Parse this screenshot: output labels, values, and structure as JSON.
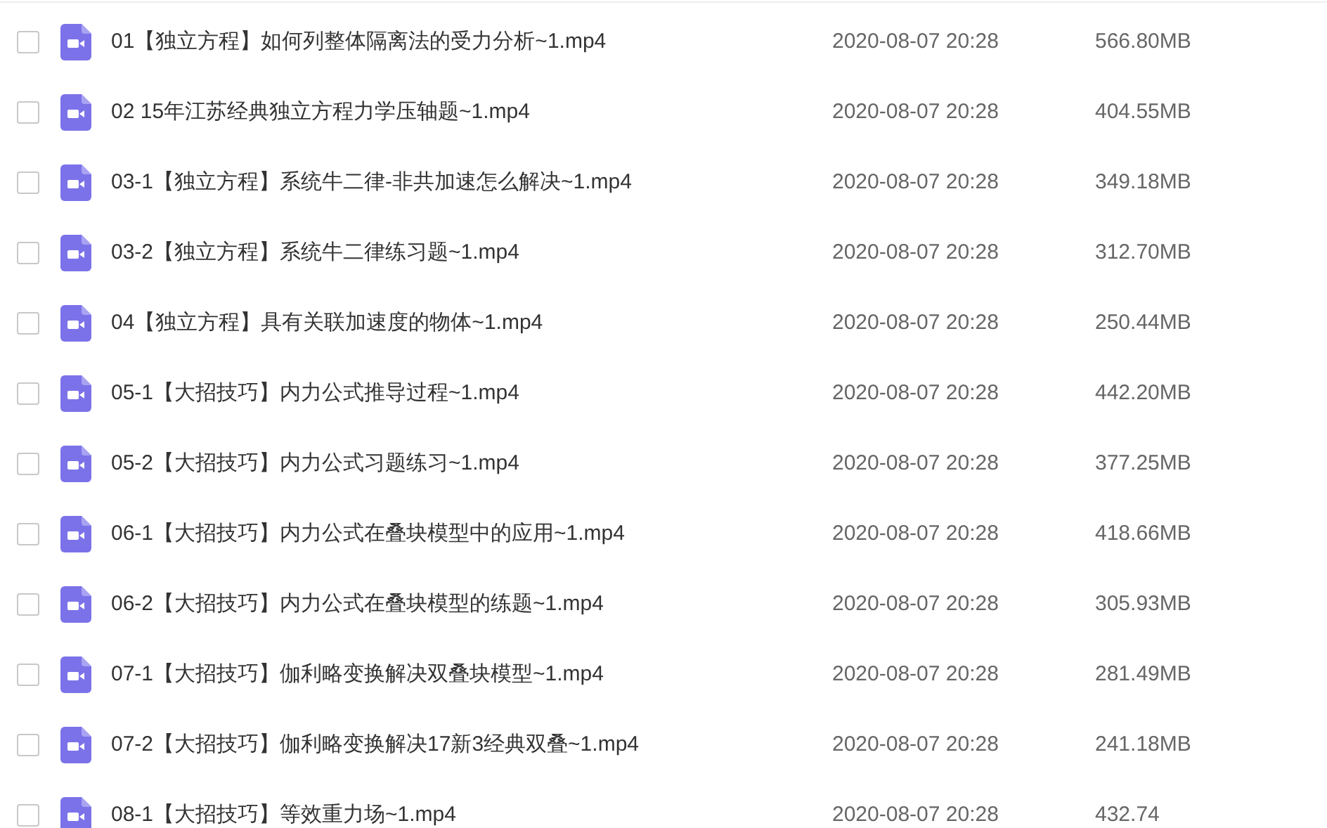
{
  "files": [
    {
      "name": "01【独立方程】如何列整体隔离法的受力分析~1.mp4",
      "modified": "2020-08-07 20:28",
      "size": "566.80MB",
      "checked": false
    },
    {
      "name": "02 15年江苏经典独立方程力学压轴题~1.mp4",
      "modified": "2020-08-07 20:28",
      "size": "404.55MB",
      "checked": false
    },
    {
      "name": "03-1【独立方程】系统牛二律-非共加速怎么解决~1.mp4",
      "modified": "2020-08-07 20:28",
      "size": "349.18MB",
      "checked": false
    },
    {
      "name": "03-2【独立方程】系统牛二律练习题~1.mp4",
      "modified": "2020-08-07 20:28",
      "size": "312.70MB",
      "checked": false
    },
    {
      "name": "04【独立方程】具有关联加速度的物体~1.mp4",
      "modified": "2020-08-07 20:28",
      "size": "250.44MB",
      "checked": false
    },
    {
      "name": "05-1【大招技巧】内力公式推导过程~1.mp4",
      "modified": "2020-08-07 20:28",
      "size": "442.20MB",
      "checked": false
    },
    {
      "name": "05-2【大招技巧】内力公式习题练习~1.mp4",
      "modified": "2020-08-07 20:28",
      "size": "377.25MB",
      "checked": false
    },
    {
      "name": "06-1【大招技巧】内力公式在叠块模型中的应用~1.mp4",
      "modified": "2020-08-07 20:28",
      "size": "418.66MB",
      "checked": false
    },
    {
      "name": "06-2【大招技巧】内力公式在叠块模型的练题~1.mp4",
      "modified": "2020-08-07 20:28",
      "size": "305.93MB",
      "checked": false
    },
    {
      "name": "07-1【大招技巧】伽利略变换解决双叠块模型~1.mp4",
      "modified": "2020-08-07 20:28",
      "size": "281.49MB",
      "checked": false
    },
    {
      "name": "07-2【大招技巧】伽利略变换解决17新3经典双叠~1.mp4",
      "modified": "2020-08-07 20:28",
      "size": "241.18MB",
      "checked": false
    },
    {
      "name": "08-1【大招技巧】等效重力场~1.mp4",
      "modified": "2020-08-07 20:28",
      "size": "432.74",
      "checked": false
    }
  ]
}
